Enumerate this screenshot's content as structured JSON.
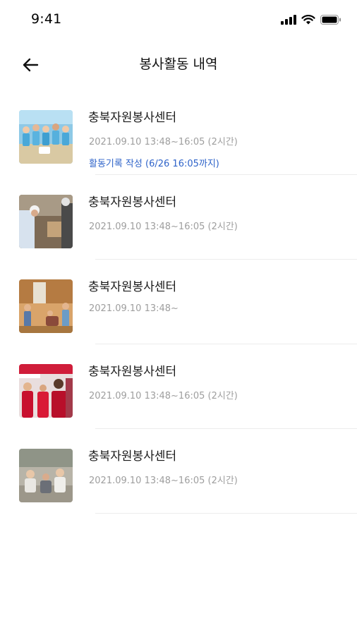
{
  "status_bar": {
    "time": "9:41"
  },
  "header": {
    "title": "봉사활동 내역"
  },
  "items": [
    {
      "name": "충북자원봉사센터",
      "date": "2021.09.10 13:48~16:05 (2시간)",
      "link": "활동기록 작성 (6/26 16:05까지)",
      "thumb": "beach-cleanup-photo"
    },
    {
      "name": "충북자원봉사센터",
      "date": "2021.09.10 13:48~16:05 (2시간)",
      "thumb": "construction-volunteer-photo"
    },
    {
      "name": "충북자원봉사센터",
      "date": "2021.09.10 13:48~",
      "thumb": "indoor-gathering-photo"
    },
    {
      "name": "충북자원봉사센터",
      "date": "2021.09.10 13:48~16:05 (2시간)",
      "thumb": "red-shirt-volunteers-photo"
    },
    {
      "name": "충북자원봉사센터",
      "date": "2021.09.10 13:48~16:05 (2시간)",
      "thumb": "outdoor-group-photo"
    }
  ]
}
